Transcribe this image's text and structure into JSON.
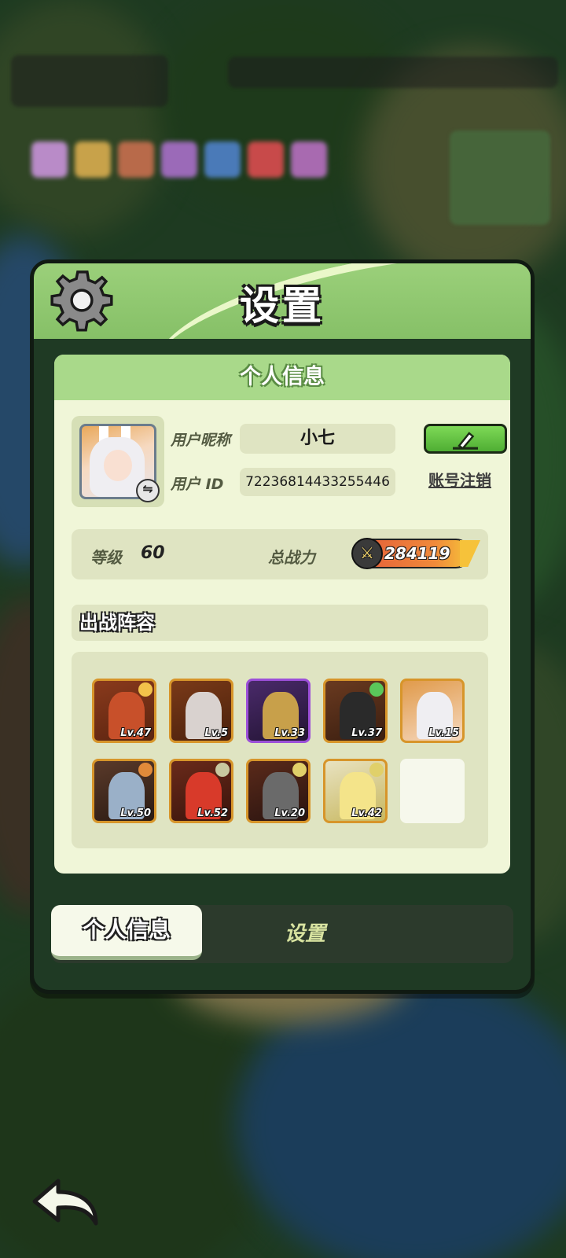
{
  "panel": {
    "title": "设置",
    "gear_icon": "gear-icon"
  },
  "profile": {
    "section_title": "个人信息",
    "nickname_label": "用户昵称",
    "nickname_value": "小七",
    "id_label": "用户 ID",
    "id_value": "7223681443325544​6",
    "edit_icon": "pencil-icon",
    "cancel_account_link": "账号注销"
  },
  "stats": {
    "level_label": "等级",
    "level_value": "60",
    "power_label": "总战力",
    "power_value": "284119"
  },
  "lineup": {
    "title": "出战阵容",
    "heroes": [
      {
        "level": "Lv.47"
      },
      {
        "level": "Lv.5"
      },
      {
        "level": "Lv.33"
      },
      {
        "level": "Lv.37"
      },
      {
        "level": "Lv.15"
      },
      {
        "level": "Lv.50"
      },
      {
        "level": "Lv.52"
      },
      {
        "level": "Lv.20"
      },
      {
        "level": "Lv.42"
      }
    ]
  },
  "tabs": {
    "active": "个人信息",
    "inactive": "设置"
  },
  "colors": {
    "header_green": "#9bd07a",
    "card_bg": "#f0f6d8",
    "edit_button": "#4fae33",
    "power_bar": "#f08a3a"
  }
}
